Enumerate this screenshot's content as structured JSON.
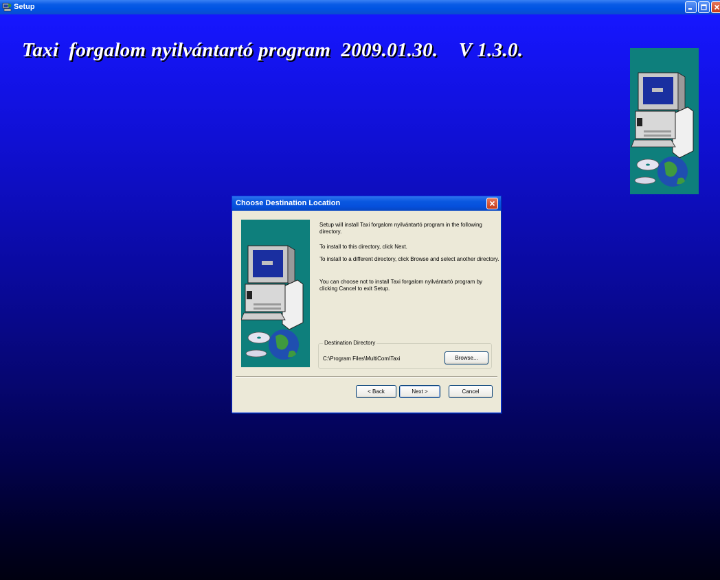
{
  "window": {
    "title": "Setup",
    "controls": {
      "minimize": "minimize",
      "maximize": "maximize",
      "close": "close"
    }
  },
  "banner": {
    "text": "Taxi  forgalom nyilvántartó program  2009.01.30.    V 1.3.0."
  },
  "dialog": {
    "title": "Choose Destination Location",
    "paragraphs": [
      "Setup will install Taxi  forgalom nyilvántartó program in the following directory.",
      "To install to this directory, click Next.",
      "To install to a different directory, click Browse and select another directory.",
      "You can choose not to install Taxi  forgalom nyilvántartó program by clicking Cancel to exit Setup."
    ],
    "destination": {
      "legend": "Destination Directory",
      "path": "C:\\Program Files\\MultiCom\\Taxi",
      "browse_label": "Browse..."
    },
    "buttons": {
      "back": "< Back",
      "next": "Next >",
      "cancel": "Cancel"
    }
  },
  "colors": {
    "titlebar": "#0054e3",
    "background_top": "#1616ff",
    "background_bottom": "#000010",
    "art_panel": "#0e7f7c",
    "dialog_face": "#ece9d8"
  },
  "icons": [
    "setup-app-icon",
    "computer-globe-art",
    "close-icon",
    "minimize-icon",
    "maximize-icon"
  ]
}
